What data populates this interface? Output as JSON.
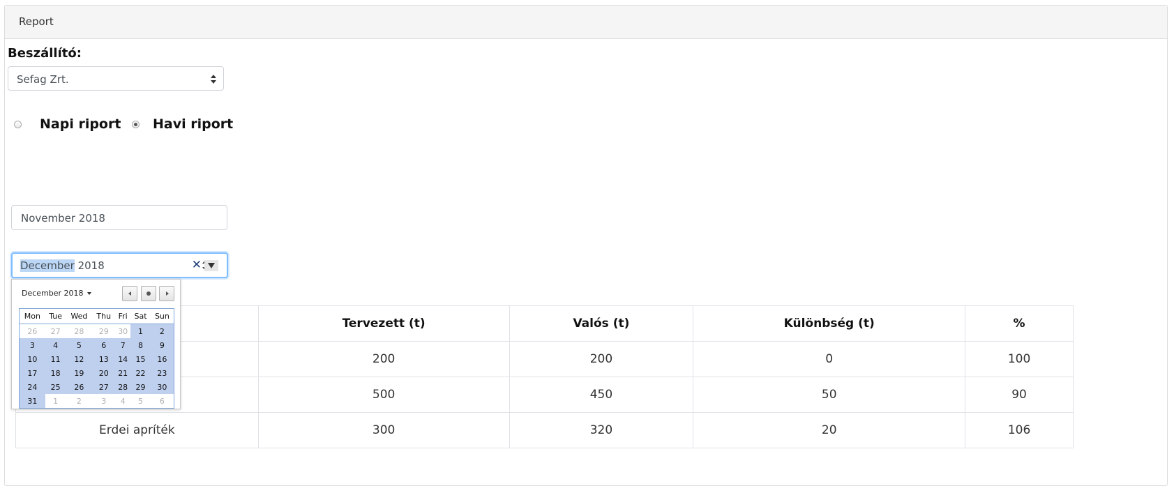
{
  "panel": {
    "title": "Report"
  },
  "supplier": {
    "label": "Beszállító:",
    "selected": "Sefag Zrt."
  },
  "report_type": {
    "options": [
      {
        "label": "Napi riport",
        "checked": false
      },
      {
        "label": "Havi riport",
        "checked": true
      }
    ]
  },
  "month_from": {
    "value": "November 2018"
  },
  "month_to": {
    "month": "December",
    "year": "2018"
  },
  "datepicker": {
    "title": "December 2018",
    "weekdays": [
      "Mon",
      "Tue",
      "Wed",
      "Thu",
      "Fri",
      "Sat",
      "Sun"
    ],
    "weeks": [
      [
        "26",
        "27",
        "28",
        "29",
        "30",
        "1",
        "2"
      ],
      [
        "3",
        "4",
        "5",
        "6",
        "7",
        "8",
        "9"
      ],
      [
        "10",
        "11",
        "12",
        "13",
        "14",
        "15",
        "16"
      ],
      [
        "17",
        "18",
        "19",
        "20",
        "21",
        "22",
        "23"
      ],
      [
        "24",
        "25",
        "26",
        "27",
        "28",
        "29",
        "30"
      ],
      [
        "31",
        "1",
        "2",
        "3",
        "4",
        "5",
        "6"
      ]
    ]
  },
  "table": {
    "headers": [
      "",
      "Tervezett (t)",
      "Valós (t)",
      "Különbség (t)",
      "%"
    ],
    "rows": [
      [
        "",
        "200",
        "200",
        "0",
        "100"
      ],
      [
        "",
        "500",
        "450",
        "50",
        "90"
      ],
      [
        "Erdei apríték",
        "300",
        "320",
        "20",
        "106"
      ]
    ]
  }
}
